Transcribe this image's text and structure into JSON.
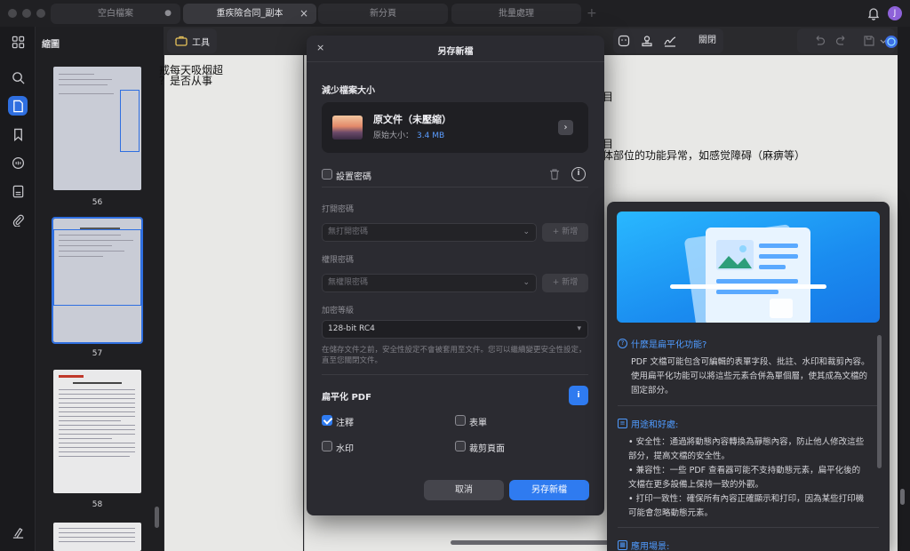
{
  "tabs": [
    {
      "label": "空白檔案",
      "indicator": "●"
    },
    {
      "label": "重疾險合同_副本",
      "close": "×"
    },
    {
      "label": "新分頁"
    },
    {
      "label": "批量處理"
    }
  ],
  "tab_add": "+",
  "user_initial": "J",
  "sidebar": {
    "title": "縮圖"
  },
  "thumbnails": [
    {
      "page": "56"
    },
    {
      "page": "57"
    },
    {
      "page": "58"
    }
  ],
  "toolbar": {
    "tools_label": "工具",
    "close_label": "關閉"
  },
  "document": {
    "left_lines": [
      "戒每天吸烟超",
      "？是否从事"
    ],
    "right_lines": [
      "目",
      "目",
      "体部位的功能异常，如感觉障碍（麻痹等）"
    ]
  },
  "dialog": {
    "title": "另存新檔",
    "close": "×",
    "reduce_title": "減少檔案大小",
    "file_name": "原文件（未壓縮）",
    "file_size_label": "原始大小：",
    "file_size_value": "3.4 MB",
    "password_label": "設置密碼",
    "open_password_label": "打開密碼",
    "open_password_placeholder": "無打開密碼",
    "permission_password_label": "權限密碼",
    "permission_password_placeholder": "無權限密碼",
    "add_label": "+ 新增",
    "encryption_label": "加密等級",
    "encryption_value": "128-bit RC4",
    "hint": "在儲存文件之前，安全性設定不會被套用至文件。您可以繼續變更安全性設定，直至您關閉文件。",
    "flatten_title": "扁平化 PDF",
    "flatten_options": [
      {
        "label": "注釋",
        "checked": true
      },
      {
        "label": "表單",
        "checked": false
      },
      {
        "label": "水印",
        "checked": false
      },
      {
        "label": "裁剪頁面",
        "checked": false
      }
    ],
    "cancel": "取消",
    "save": "另存新檔"
  },
  "info_panel": {
    "q1_title": "什麼是扁平化功能?",
    "q1_text": "PDF 文檔可能包含可編輯的表單字段、批註、水印和裁剪內容。使用扁平化功能可以將這些元素合併為單個層，使其成為文檔的固定部分。",
    "q2_title": "用途和好處:",
    "q2_items": [
      "• 安全性：通過將動態內容轉換為靜態內容，防止他人修改這些部分，提高文檔的安全性。",
      "• 兼容性：一些 PDF 查看器可能不支持動態元素，扁平化後的文檔在更多設備上保持一致的外觀。",
      "• 打印一致性：確保所有內容正確顯示和打印，因為某些打印機可能會忽略動態元素。"
    ],
    "q3_title": "應用場景:"
  },
  "colors": {
    "accent": "#2f7bf0",
    "panel": "#2b2b31",
    "link": "#4f9bff"
  }
}
